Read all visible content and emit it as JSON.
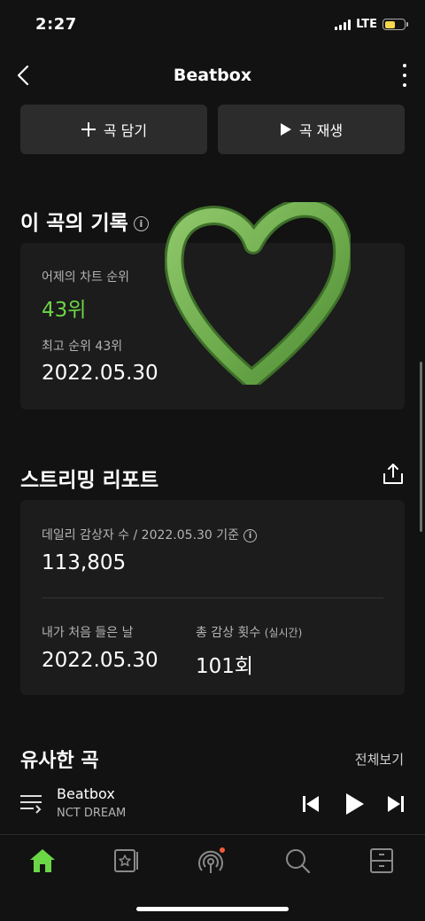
{
  "status_bar": {
    "time": "2:27",
    "network": "LTE",
    "battery_color": "#f6d64a"
  },
  "header": {
    "title": "Beatbox",
    "back_icon": "chevron-left-icon",
    "more_icon": "more-vertical-icon"
  },
  "actions": {
    "add_label": "곡 담기",
    "play_label": "곡 재생"
  },
  "history": {
    "title": "이 곡의 기록",
    "yesterday_rank_label": "어제의 차트 순위",
    "yesterday_rank_value": "43위",
    "best_rank_label": "최고 순위 43위",
    "best_rank_date": "2022.05.30"
  },
  "streaming": {
    "title": "스트리밍 리포트",
    "daily_listeners_label": "데일리 감상자 수 / 2022.05.30 기준",
    "daily_listeners_value": "113,805",
    "first_listened_label": "내가 처음 들은 날",
    "first_listened_value": "2022.05.30",
    "total_plays_label": "총 감상 횟수",
    "total_plays_suffix": "(실시간)",
    "total_plays_value": "101회"
  },
  "similar": {
    "title": "유사한 곡",
    "see_all": "전체보기"
  },
  "now_playing": {
    "title": "Beatbox",
    "artist": "NCT DREAM"
  },
  "colors": {
    "accent_green": "#6bd646",
    "background": "#121212",
    "card": "#1c1c1c",
    "notification_dot": "#f05a3c"
  },
  "tabs": [
    "home-icon",
    "library-star-icon",
    "podcast-icon",
    "search-icon",
    "storage-icon"
  ]
}
